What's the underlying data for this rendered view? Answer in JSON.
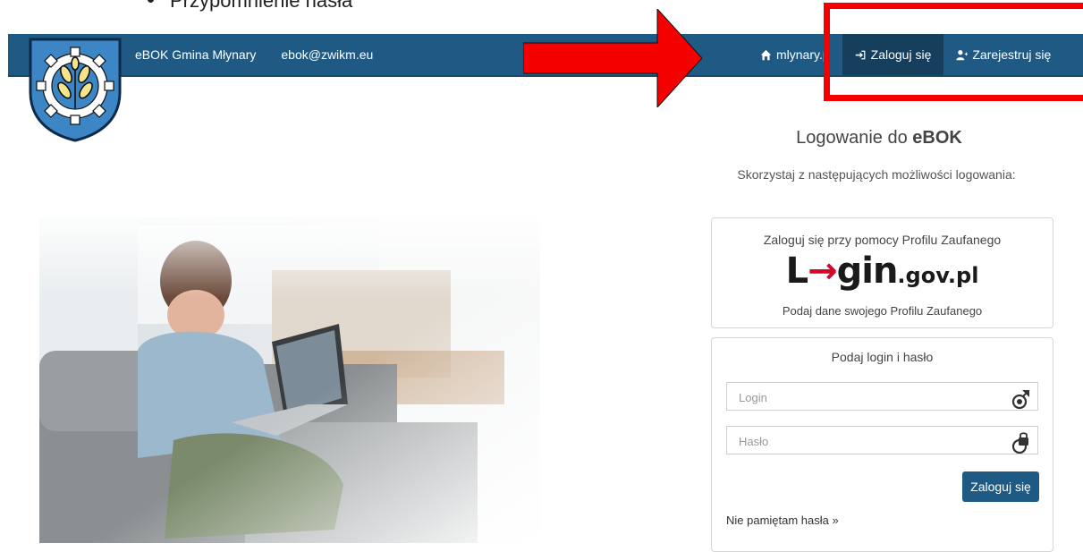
{
  "doc": {
    "bullet_text": "Przypomnienie hasła"
  },
  "navbar": {
    "brand": "eBOK Gmina Młynary",
    "email": "ebok@zwikm.eu",
    "home_label": "mlynary.p",
    "login_label": "Zaloguj się",
    "register_label": "Zarejestruj się"
  },
  "main": {
    "title_prefix": "Logowanie do ",
    "title_bold": "eBOK",
    "subtitle": "Skorzystaj z następujących możliwości logowania:"
  },
  "trusted_profile": {
    "heading": "Zaloguj się przy pomocy Profilu Zaufanego",
    "logo_text": "Login.gov.pl",
    "logo_l": "L",
    "logo_o": "→",
    "logo_gin": "gin",
    "logo_domain": ".gov.pl",
    "link": "Podaj dane swojego Profilu Zaufanego"
  },
  "login_form": {
    "heading": "Podaj login i hasło",
    "login_placeholder": "Login",
    "login_value": "",
    "password_placeholder": "Hasło",
    "password_value": "",
    "submit_label": "Zaloguj się",
    "forgot_label": "Nie pamiętam hasła »"
  },
  "colors": {
    "navbar": "#1f5a85",
    "active_nav": "#163f5e",
    "annotation": "#f40000",
    "button": "#1f5a85"
  },
  "icons": [
    "home-icon",
    "sign-in-icon",
    "user-plus-icon",
    "user-login-icon",
    "lock-icon",
    "right-arrow-annotation",
    "coat-of-arms-icon"
  ]
}
